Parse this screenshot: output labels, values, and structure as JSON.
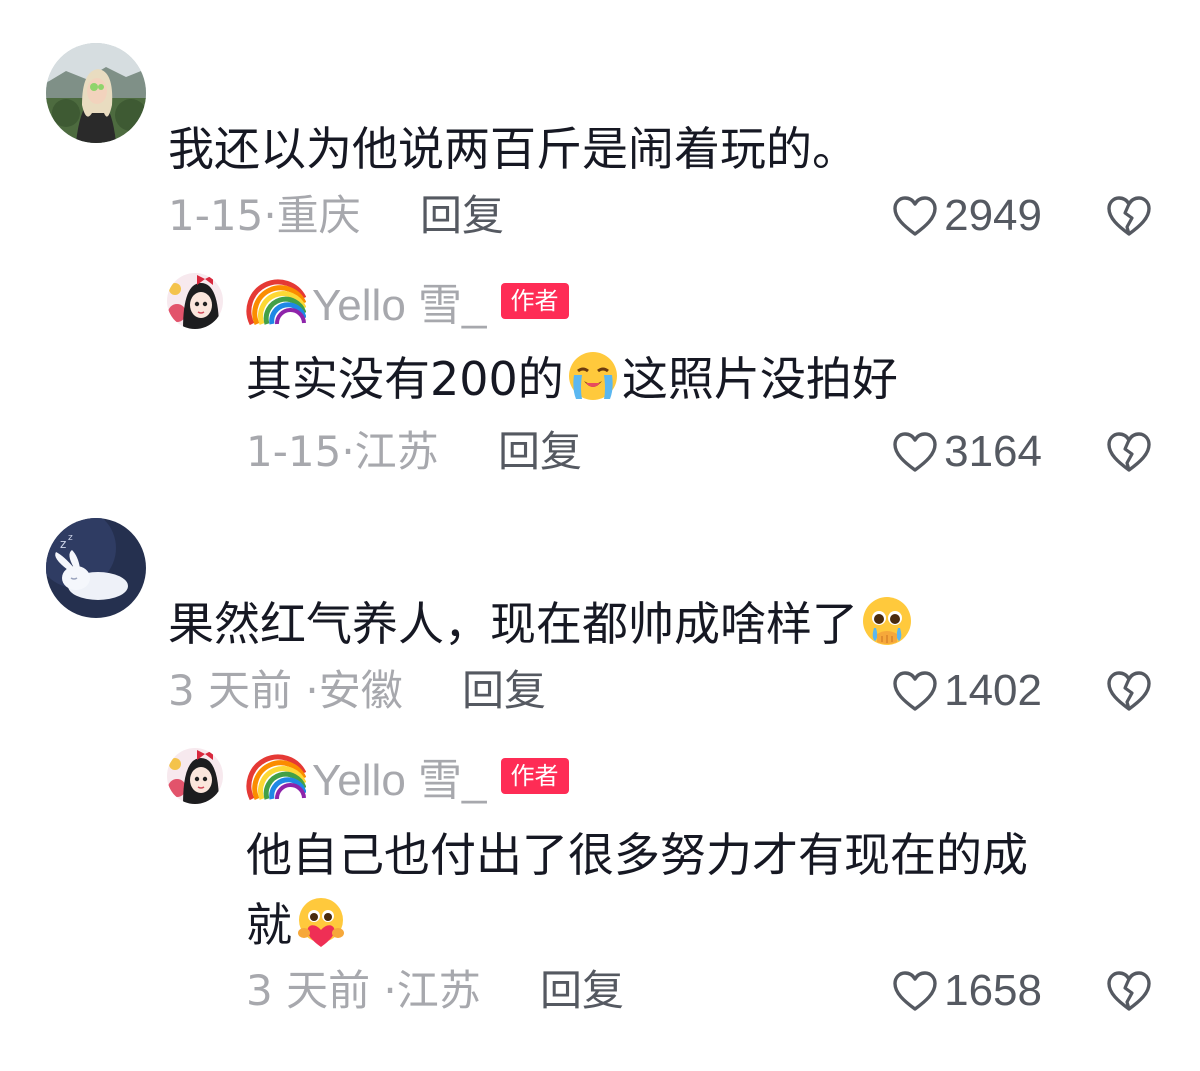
{
  "comments": [
    {
      "text": "我还以为他说两百斤是闹着玩的。",
      "meta": "1-15·重庆",
      "reply_label": "回复",
      "likes": "2949",
      "avatar_icon": "girl-landscape-avatar",
      "reply": {
        "username": "Yello 雪_",
        "badge": "作者",
        "text_before": "其实没有200的",
        "emoji": "loudly-crying-emoji",
        "text_after": "这照片没拍好",
        "meta": "1-15·江苏",
        "reply_label": "回复",
        "likes": "3164"
      }
    },
    {
      "text_before": "果然红气养人，现在都帅成啥样了",
      "emoji": "pleading-emoji",
      "meta": "3 天前 ·安徽",
      "reply_label": "回复",
      "likes": "1402",
      "avatar_icon": "sleeping-bunny-avatar",
      "reply": {
        "username": "Yello 雪_",
        "badge": "作者",
        "text_line1": "他自己也付出了很多努力才有现在的成",
        "text_line2": "就",
        "emoji": "hugging-heart-emoji",
        "meta": "3 天前 ·江苏",
        "reply_label": "回复",
        "likes": "1658"
      }
    }
  ],
  "colors": {
    "author_badge": "#fe2c55",
    "meta_text": "#a7a8ad",
    "action_text": "#555961"
  }
}
